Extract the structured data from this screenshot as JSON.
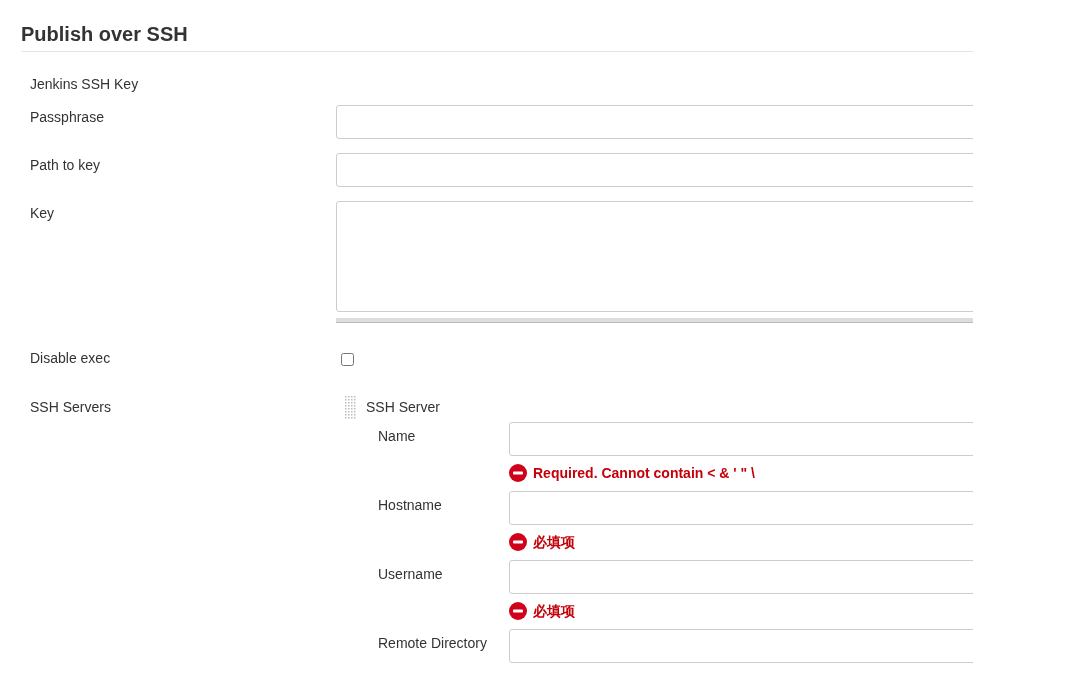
{
  "section": {
    "title": "Publish over SSH"
  },
  "fields": [
    {
      "kind": "heading",
      "label": "Jenkins SSH Key"
    },
    {
      "kind": "text",
      "label": "Passphrase"
    },
    {
      "kind": "text",
      "label": "Path to key"
    },
    {
      "kind": "textarea",
      "label": "Key"
    },
    {
      "kind": "checkbox",
      "label": "Disable exec",
      "checked": false
    },
    {
      "kind": "servers",
      "label": "SSH Servers"
    }
  ],
  "server": {
    "title": "SSH Server",
    "fields": [
      {
        "label": "Name",
        "error": "Required. Cannot contain < & ' \" \\"
      },
      {
        "label": "Hostname",
        "error": "必填项"
      },
      {
        "label": "Username",
        "error": "必填项"
      },
      {
        "label": "Remote Directory"
      }
    ]
  }
}
